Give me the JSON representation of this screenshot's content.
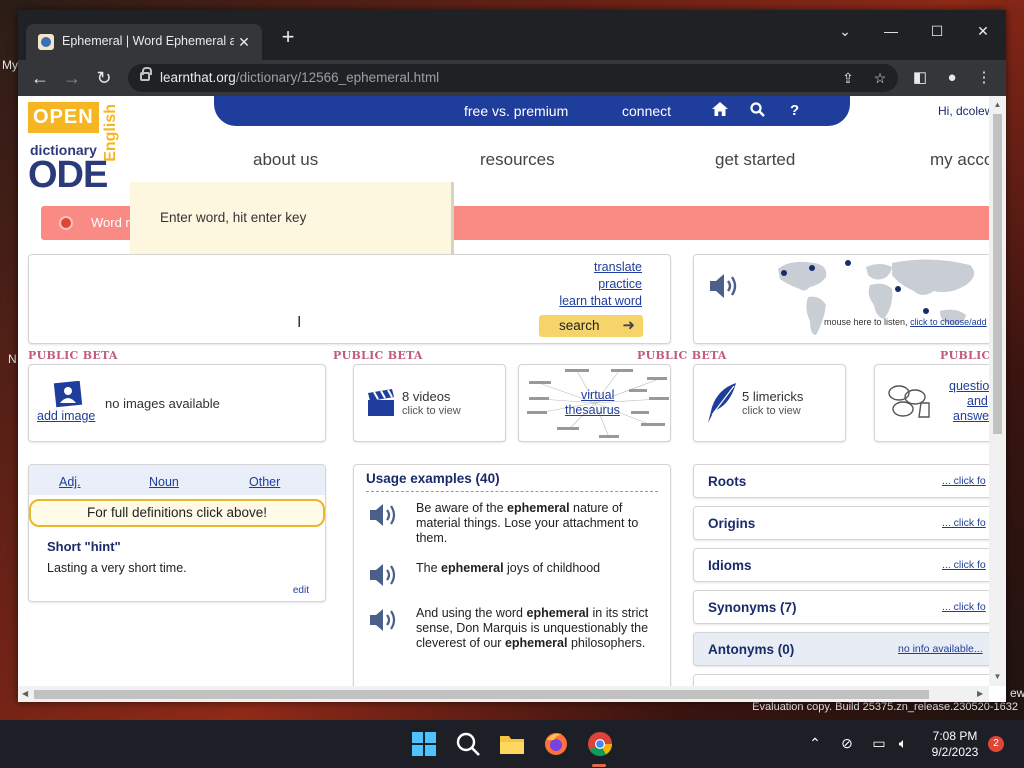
{
  "desktop": {
    "left_fragment_top": "My",
    "left_fragment_bottom": "N",
    "right_fragment": "ew",
    "evaluation_text": "Evaluation copy. Build 25375.zn_release.230520-1632"
  },
  "browser": {
    "tab_title": "Ephemeral | Word Ephemeral at C",
    "url_host": "learnthat.org",
    "url_path": "/dictionary/12566_ephemeral.html"
  },
  "page": {
    "logo": {
      "open": "OPEN",
      "dictionary": "dictionary",
      "ode": "ODE",
      "english": "English"
    },
    "topbar": {
      "free_vs_premium": "free vs. premium",
      "connect": "connect",
      "help": "?"
    },
    "greeting": "Hi, dcolew",
    "mainnav": [
      "about us",
      "resources",
      "get started",
      "my acco"
    ],
    "word_strip_text": "Word n",
    "tooltip_text": "Enter word, hit enter key",
    "search_links": [
      "translate",
      "practice",
      "learn that word"
    ],
    "search_button": "search",
    "listen": {
      "prefix": "mouse here to listen,",
      "link": "click to choose/add"
    },
    "beta_label": "PUBLIC BETA",
    "beta_label_cut": "PUBLIC",
    "images_card": {
      "link": "add image",
      "text": "no images available"
    },
    "videos_card": {
      "title": "8 videos",
      "sub": "click to view"
    },
    "thesaurus_card": {
      "link_line1": "virtual",
      "link_line2": "thesaurus"
    },
    "limericks_card": {
      "title": "5 limericks",
      "sub": "click to view"
    },
    "qa_card": {
      "line1": "questio",
      "line2": "and",
      "line3": "answe"
    },
    "definition": {
      "tabs": [
        "Adj.",
        "Noun",
        "Other"
      ],
      "full_def_prompt": "For full definitions click above!",
      "hint_title": "Short \"hint\"",
      "hint_text": "Lasting a very short time.",
      "edit": "edit"
    },
    "usage": {
      "title": "Usage examples (40)",
      "examples": [
        {
          "before": "Be aware of the ",
          "bold": "ephemeral",
          "after": " nature of material things. Lose your attachment to them."
        },
        {
          "before": "The ",
          "bold": "ephemeral",
          "after": " joys of childhood"
        },
        {
          "before": "And using the word ",
          "bold": "ephemeral",
          "after": " in its strict sense, Don Marquis is unquestionably the cleverest of our ",
          "bold2": "ephemeral",
          "after2": " philosophers."
        }
      ]
    },
    "side_panels": [
      {
        "title": "Roots",
        "link": "... click fo"
      },
      {
        "title": "Origins",
        "link": "... click fo"
      },
      {
        "title": "Idioms",
        "link": "... click fo"
      },
      {
        "title": "Synonyms (7)",
        "link": "... click fo"
      },
      {
        "title": "Antonyms (0)",
        "link": "no info available..."
      }
    ]
  },
  "taskbar": {
    "time": "7:08 PM",
    "date": "9/2/2023",
    "notification_count": "2"
  },
  "colors": {
    "navy": "#1f3e9c",
    "word_strip": "#fa8a84",
    "search_button": "#f6d46a",
    "beta": "#c25c7c"
  }
}
